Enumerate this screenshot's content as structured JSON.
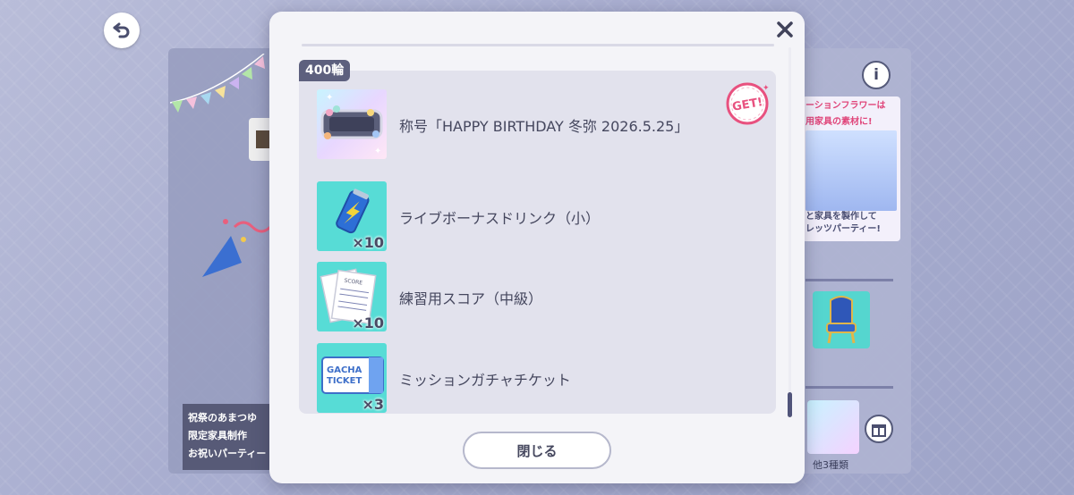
{
  "background": {
    "left_captions": [
      "祝祭のあまつゆ",
      "限定家具制作",
      "お祝いパーティー"
    ],
    "right_banner": {
      "line1": "ーションフラワーは",
      "line2": "用家具の素材に!",
      "line3": "と家具を製作して",
      "line4": "レッツパーティー!"
    },
    "right_caption": "他3種類"
  },
  "modal": {
    "tier_label": "400輪",
    "close_label": "閉じる",
    "get_badge": "GET!",
    "items": [
      {
        "name": "称号「HAPPY BIRTHDAY 冬弥 2026.5.25」",
        "qty": "",
        "icon": "title-plate-icon"
      },
      {
        "name": "ライブボーナスドリンク（小）",
        "qty": "×10",
        "icon": "energy-drink-icon"
      },
      {
        "name": "練習用スコア（中級）",
        "qty": "×10",
        "icon": "score-sheet-icon"
      },
      {
        "name": "ミッションガチャチケット",
        "qty": "×3",
        "icon": "gacha-ticket-icon"
      }
    ]
  },
  "colors": {
    "accent_pink": "#e8517f",
    "dark_text": "#45475e",
    "tag_bg": "#5d607e",
    "item_bg": "#57dcd6"
  }
}
